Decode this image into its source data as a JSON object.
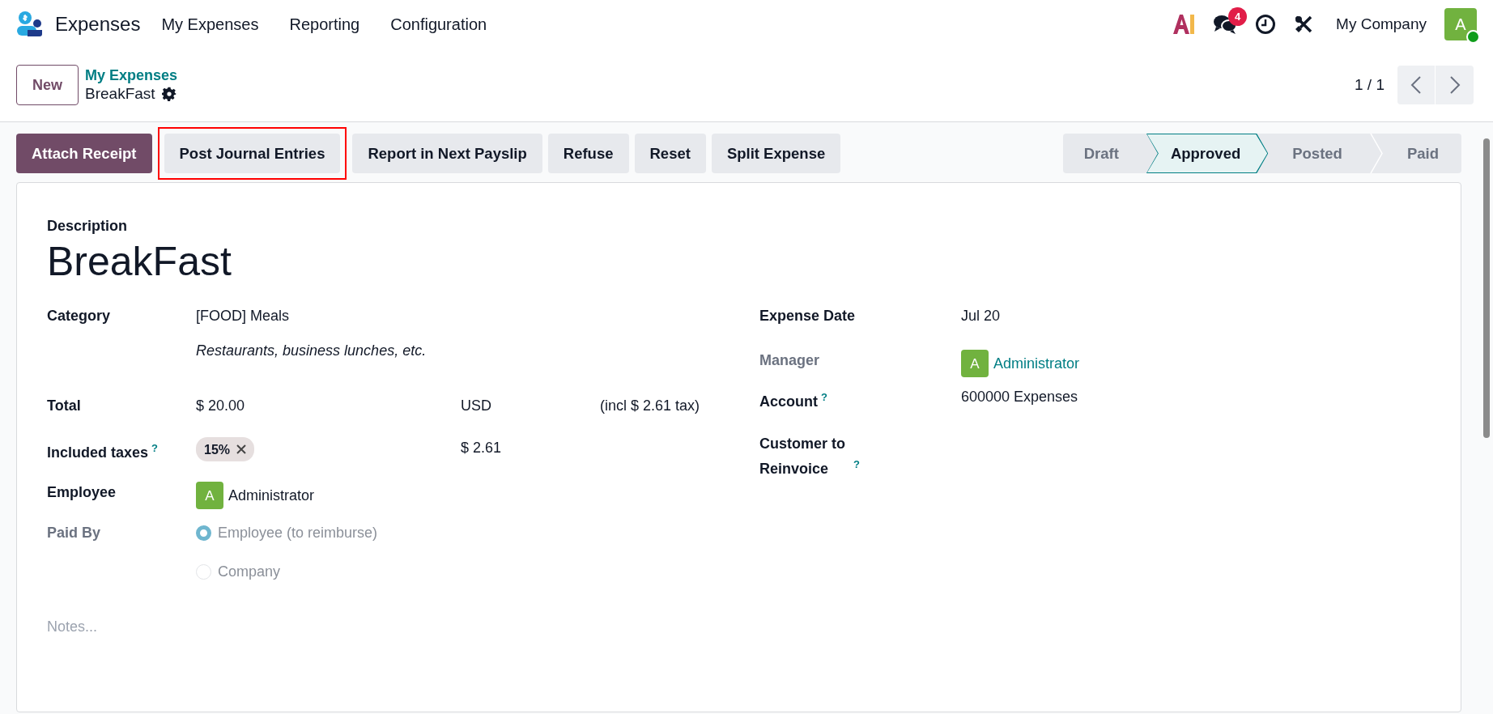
{
  "navbar": {
    "app_name": "Expenses",
    "menu": [
      "My Expenses",
      "Reporting",
      "Configuration"
    ],
    "message_count": "4",
    "company": "My Company",
    "avatar_letter": "A",
    "online": true
  },
  "control_panel": {
    "new_button": "New",
    "breadcrumb": "My Expenses",
    "record_title": "BreakFast",
    "pager": "1 / 1"
  },
  "actions": [
    {
      "label": "Attach Receipt",
      "kind": "primary",
      "highlighted": false
    },
    {
      "label": "Post Journal Entries",
      "kind": "secondary",
      "highlighted": true
    },
    {
      "label": "Report in Next Payslip",
      "kind": "secondary",
      "highlighted": false
    },
    {
      "label": "Refuse",
      "kind": "secondary",
      "highlighted": false
    },
    {
      "label": "Reset",
      "kind": "secondary",
      "highlighted": false
    },
    {
      "label": "Split Expense",
      "kind": "secondary",
      "highlighted": false
    }
  ],
  "status_steps": [
    {
      "label": "Draft",
      "selected": false
    },
    {
      "label": "Approved",
      "selected": true
    },
    {
      "label": "Posted",
      "selected": false
    },
    {
      "label": "Paid",
      "selected": false
    }
  ],
  "form": {
    "description_label": "Description",
    "title": "BreakFast",
    "left_fields": [
      {
        "kind": "category",
        "label": "Category",
        "muted": false,
        "value": "[FOOD] Meals",
        "note": "Restaurants, business lunches, etc."
      },
      {
        "kind": "amount",
        "label": "Total",
        "muted": false,
        "value": "$ 20.00",
        "currency": "USD",
        "tax_note": "(incl $ 2.61 tax)"
      },
      {
        "kind": "tags",
        "label": "Included taxes",
        "help": "?",
        "muted": false,
        "tags": [
          "15%"
        ],
        "amount": "$ 2.61"
      },
      {
        "kind": "avatar",
        "label": "Employee",
        "muted": false,
        "avatar_letter": "A",
        "value": "Administrator",
        "link": false
      },
      {
        "kind": "radio",
        "label": "Paid By",
        "muted": true,
        "options": [
          {
            "label": "Employee (to reimburse)",
            "selected": true
          },
          {
            "label": "Company",
            "selected": false
          }
        ]
      }
    ],
    "right_fields": [
      {
        "kind": "text",
        "label": "Expense Date",
        "muted": false,
        "value": "Jul 20"
      },
      {
        "kind": "avatar",
        "label": "Manager",
        "muted": true,
        "avatar_letter": "A",
        "value": "Administrator",
        "link": true
      },
      {
        "kind": "text",
        "label": "Account",
        "help": "?",
        "muted": false,
        "value": "600000 Expenses"
      },
      {
        "kind": "text",
        "label": "Customer to Reinvoice",
        "help": "?",
        "muted": false
      }
    ],
    "notes_placeholder": "Notes..."
  }
}
